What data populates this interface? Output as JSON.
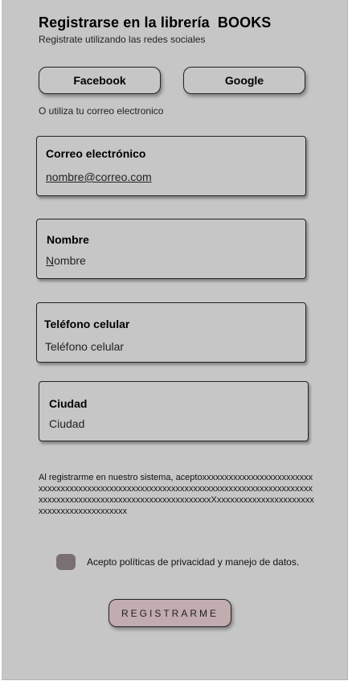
{
  "header": {
    "title": "Registrarse en la librería  BOOKS",
    "subtitle": "Registrate utilizando las redes sociales"
  },
  "social": {
    "facebook_label": "Facebook",
    "google_label": "Google",
    "alt_text": "O utiliza tu correo electronico"
  },
  "form": {
    "email": {
      "label": "Correo electrónico",
      "value": "nombre@correo.com"
    },
    "name": {
      "label": "Nombre",
      "first_letter": "N",
      "rest": "ombre"
    },
    "phone": {
      "label": "Teléfono celular",
      "value": "Teléfono celular"
    },
    "city": {
      "label": "Ciudad",
      "value": "Ciudad"
    }
  },
  "terms": {
    "text": "Al registrarme en nuestro sistema, aceptoxxxxxxxxxxxxxxxxxxxxxxxxxxxxxxxxxxxxxxxxxxxxxxxxxxxxxxxxxxxxxxxxxxxxxxxxxxxxxxxxxxxxxxxxxxxxxxxxxxxxxxxxxxxxxxxxxxxxxxxxxxxxxxXxxxxxxxxxxxxxxxxxxxxxxxxxxxxxxxxxxxxxxxxxx"
  },
  "consent": {
    "label": "Acepto políticas de privacidad y manejo de datos.",
    "checked": false
  },
  "actions": {
    "register_label": "REGISTRARME"
  },
  "colors": {
    "background": "#c6c6c6",
    "checkbox": "#7a6f72",
    "register_button": "#c1acaf"
  }
}
